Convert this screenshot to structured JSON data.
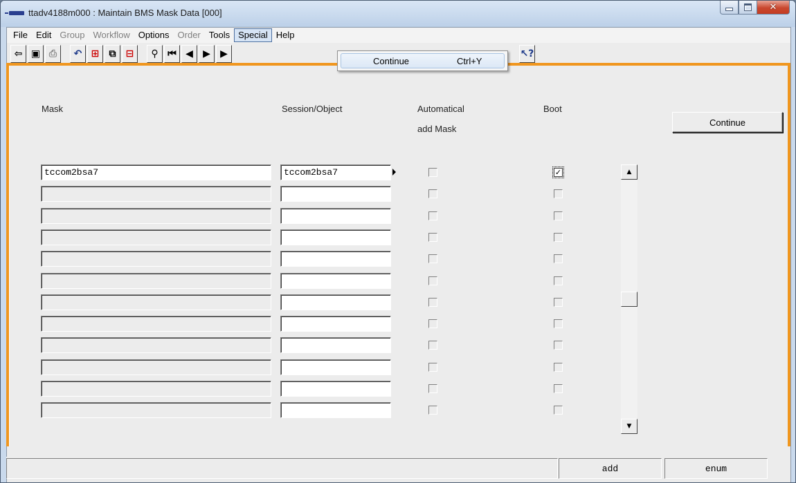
{
  "window": {
    "title": "ttadv4188m000 : Maintain BMS Mask Data [000]",
    "minimize_glyph": "",
    "close_glyph": "✕"
  },
  "menubar": {
    "items": [
      {
        "label": "File",
        "enabled": true
      },
      {
        "label": "Edit",
        "enabled": true
      },
      {
        "label": "Group",
        "enabled": false
      },
      {
        "label": "Workflow",
        "enabled": false
      },
      {
        "label": "Options",
        "enabled": true
      },
      {
        "label": "Order",
        "enabled": false
      },
      {
        "label": "Tools",
        "enabled": true
      },
      {
        "label": "Special",
        "enabled": true,
        "open": true
      },
      {
        "label": "Help",
        "enabled": true
      }
    ]
  },
  "special_menu": {
    "items": [
      {
        "label": "Continue",
        "shortcut": "Ctrl+Y"
      }
    ]
  },
  "toolbar": {
    "icons": [
      "exit-icon",
      "save-icon",
      "print-icon",
      "undo-icon",
      "insert-record-icon",
      "copy-icon",
      "duplicate-record-icon",
      "find-icon",
      "first-record-icon",
      "previous-record-icon",
      "next-record-icon",
      "last-record-icon",
      "context-help-icon"
    ],
    "glyphs": {
      "exit": "⇦",
      "save": "▣",
      "print": "⎙",
      "undo": "↶",
      "insert": "⊞",
      "copy": "⧉",
      "duplicate": "⊟",
      "find": "⚲",
      "first": "⏮",
      "prev": "◀",
      "next": "▶",
      "last": "▶",
      "help": "↖?"
    }
  },
  "form": {
    "headers": {
      "mask": "Mask",
      "session_object": "Session/Object",
      "automatical_line1": "Automatical",
      "automatical_line2": "add Mask",
      "boot": "Boot"
    },
    "continue_label": "Continue",
    "rows": [
      {
        "mask": "tccom2bsa7",
        "session_object": "tccom2bsa7",
        "automatical_add_mask": false,
        "boot": true
      },
      {
        "mask": "",
        "session_object": "",
        "automatical_add_mask": false,
        "boot": false
      },
      {
        "mask": "",
        "session_object": "",
        "automatical_add_mask": false,
        "boot": false
      },
      {
        "mask": "",
        "session_object": "",
        "automatical_add_mask": false,
        "boot": false
      },
      {
        "mask": "",
        "session_object": "",
        "automatical_add_mask": false,
        "boot": false
      },
      {
        "mask": "",
        "session_object": "",
        "automatical_add_mask": false,
        "boot": false
      },
      {
        "mask": "",
        "session_object": "",
        "automatical_add_mask": false,
        "boot": false
      },
      {
        "mask": "",
        "session_object": "",
        "automatical_add_mask": false,
        "boot": false
      },
      {
        "mask": "",
        "session_object": "",
        "automatical_add_mask": false,
        "boot": false
      },
      {
        "mask": "",
        "session_object": "",
        "automatical_add_mask": false,
        "boot": false
      },
      {
        "mask": "",
        "session_object": "",
        "automatical_add_mask": false,
        "boot": false
      },
      {
        "mask": "",
        "session_object": "",
        "automatical_add_mask": false,
        "boot": false
      }
    ],
    "scroll": {
      "up": "▲",
      "down": "▼",
      "position_fraction": 0.5
    }
  },
  "statusbar": {
    "message": "",
    "mode1": "add",
    "mode2": "enum"
  },
  "colors": {
    "accent_border": "#f0961e",
    "title_bar": "#c9d9ec",
    "close_button": "#c9482f"
  }
}
